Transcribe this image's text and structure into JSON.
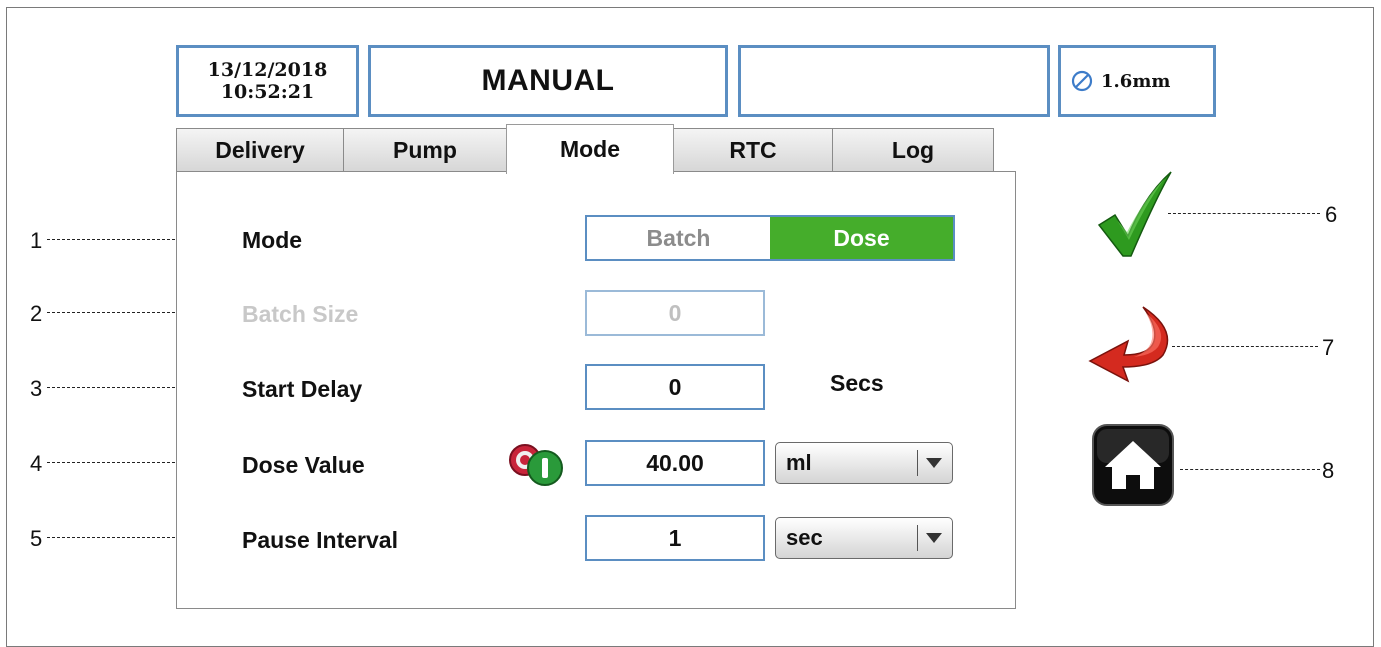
{
  "header": {
    "date": "13/12/2018",
    "time": "10:52:21",
    "mode_title": "MANUAL",
    "status_blank": "",
    "tube_size": "1.6mm",
    "tube_icon": "no-symbol-icon"
  },
  "tabs": [
    {
      "label": "Delivery"
    },
    {
      "label": "Pump"
    },
    {
      "label": "Mode"
    },
    {
      "label": "RTC"
    },
    {
      "label": "Log"
    }
  ],
  "active_tab": "Mode",
  "form": {
    "mode_label": "Mode",
    "mode_options": [
      "Batch",
      "Dose"
    ],
    "mode_selected": "Dose",
    "batch_size_label": "Batch Size",
    "batch_size_value": "0",
    "start_delay_label": "Start Delay",
    "start_delay_value": "0",
    "start_delay_unit": "Secs",
    "dose_value_label": "Dose Value",
    "dose_value": "40.00",
    "dose_unit": "ml",
    "pause_interval_label": "Pause Interval",
    "pause_interval_value": "1",
    "pause_interval_unit": "sec"
  },
  "side_buttons": [
    {
      "icon": "checkmark-icon",
      "color": "#2e9a1f"
    },
    {
      "icon": "back-arrow-icon",
      "color": "#d42a1f"
    },
    {
      "icon": "home-icon",
      "color": "#111111"
    }
  ],
  "callouts": [
    "1",
    "2",
    "3",
    "4",
    "5",
    "6",
    "7",
    "8"
  ],
  "colors": {
    "border_blue": "#5b8ec2",
    "selected_green": "#45ad2b"
  }
}
